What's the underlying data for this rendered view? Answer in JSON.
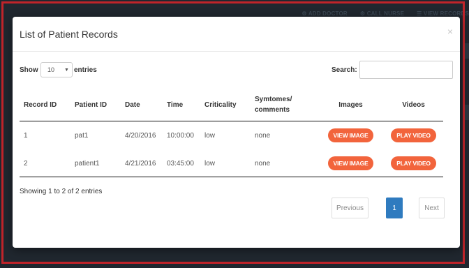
{
  "background_nav": {
    "add_doctor": "ADD DOCTOR",
    "call_nurse": "CALL NURSE",
    "view_records": "VIEW RECORDS"
  },
  "modal": {
    "title": "List of Patient Records",
    "close": "×"
  },
  "controls": {
    "show_label": "Show",
    "page_size_value": "10",
    "entries_label": "entries",
    "search_label": "Search:",
    "search_value": ""
  },
  "table": {
    "headers": {
      "record_id": "Record ID",
      "patient_id": "Patient ID",
      "date": "Date",
      "time": "Time",
      "criticality": "Criticality",
      "symptoms": "Symtomes/ comments",
      "images": "Images",
      "videos": "Videos"
    },
    "rows": [
      {
        "record_id": "1",
        "patient_id": "pat1",
        "date": "4/20/2016",
        "time": "10:00:00",
        "criticality": "low",
        "symptoms": "none",
        "image_btn": "VIEW IMAGE",
        "video_btn": "PLAY VIDEO"
      },
      {
        "record_id": "2",
        "patient_id": "patient1",
        "date": "4/21/2016",
        "time": "03:45:00",
        "criticality": "low",
        "symptoms": "none",
        "image_btn": "VIEW IMAGE",
        "video_btn": "PLAY VIDEO"
      }
    ]
  },
  "footer": {
    "info": "Showing 1 to 2 of 2 entries",
    "previous": "Previous",
    "current_page": "1",
    "next": "Next"
  },
  "colors": {
    "accent_button": "#f2643c",
    "active_page": "#2f7bbf",
    "frame_border": "#c0242a"
  }
}
